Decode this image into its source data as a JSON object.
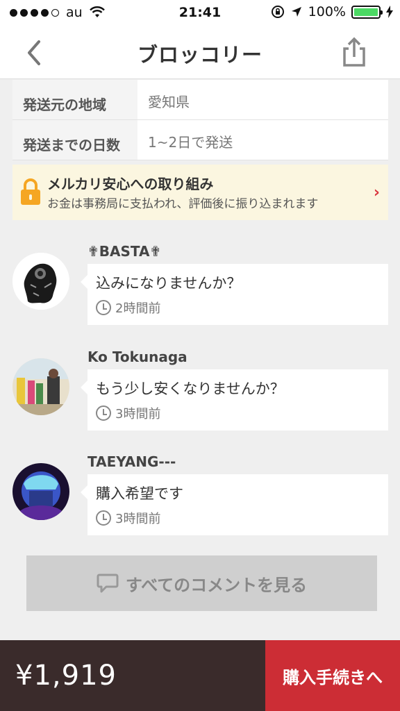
{
  "status_bar": {
    "carrier": "au",
    "time": "21:41",
    "battery": "100%"
  },
  "nav": {
    "title": "ブロッコリー"
  },
  "info_rows": [
    {
      "label": "発送元の地域",
      "value": "愛知県"
    },
    {
      "label": "発送までの日数",
      "value": "1~2日で発送"
    }
  ],
  "safety": {
    "title": "メルカリ安心への取り組み",
    "subtitle": "お金は事務局に支払われ、評価後に振り込まれます"
  },
  "comments": [
    {
      "name": "✟BASTA✟",
      "message": "込みになりませんか？",
      "time": "2時間前"
    },
    {
      "name": "Ko Tokunaga",
      "message": "もう少し安くなりませんか？",
      "time": "3時間前"
    },
    {
      "name": "TAEYANG---",
      "message": "購入希望です",
      "time": "3時間前"
    }
  ],
  "all_comments_label": "すべてのコメントを見る",
  "footer": {
    "price": "¥1,919",
    "buy_label": "購入手続きへ"
  },
  "colors": {
    "buy_button": "#cc2d35",
    "price_bar": "#3a2b2b",
    "safety_bg": "#fbf6e0",
    "lock": "#f5a623"
  }
}
